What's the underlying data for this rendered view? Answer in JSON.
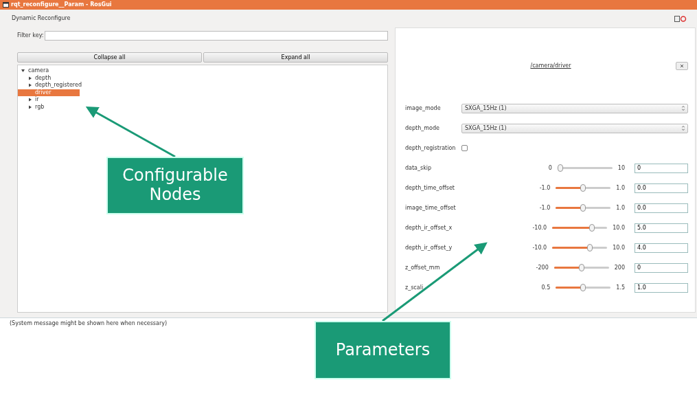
{
  "window": {
    "title": "rqt_reconfigure__Param - RosGui"
  },
  "header": {
    "title": "Dynamic Reconfigure"
  },
  "filter": {
    "label": "Filter key:"
  },
  "buttons": [
    "Collapse all",
    "Expand all"
  ],
  "tree": [
    {
      "label": "camera",
      "expanded": true,
      "selected": false,
      "children": [
        {
          "label": "depth",
          "expanded": false,
          "selected": false
        },
        {
          "label": "depth_registered",
          "expanded": false,
          "selected": false
        },
        {
          "label": "driver",
          "selected": true
        },
        {
          "label": "ir",
          "expanded": false,
          "selected": false
        },
        {
          "label": "rgb",
          "expanded": false,
          "selected": false
        }
      ]
    }
  ],
  "node": {
    "title": "/camera/driver"
  },
  "params": [
    {
      "name": "image_mode",
      "kind": "select",
      "value": "SXGA_15Hz (1)"
    },
    {
      "name": "depth_mode",
      "kind": "select",
      "value": "SXGA_15Hz (1)"
    },
    {
      "name": "depth_registration",
      "kind": "checkbox",
      "checked": false
    },
    {
      "name": "data_skip",
      "kind": "slider",
      "min": "0",
      "max": "10",
      "level": 0,
      "value": "0"
    },
    {
      "name": "depth_time_offset",
      "kind": "slider",
      "min": "-1.0",
      "max": "1.0",
      "level": 0.5,
      "value": "0.0"
    },
    {
      "name": "image_time_offset",
      "kind": "slider",
      "min": "-1.0",
      "max": "1.0",
      "level": 0.5,
      "value": "0.0"
    },
    {
      "name": "depth_ir_offset_x",
      "kind": "slider",
      "min": "-10.0",
      "max": "10.0",
      "level": 0.75,
      "value": "5.0"
    },
    {
      "name": "depth_ir_offset_y",
      "kind": "slider",
      "min": "-10.0",
      "max": "10.0",
      "level": 0.7,
      "value": "4.0"
    },
    {
      "name": "z_offset_mm",
      "kind": "slider",
      "min": "-200",
      "max": "200",
      "level": 0.5,
      "value": "0"
    },
    {
      "name": "z_scali",
      "kind": "slider",
      "min": "0.5",
      "max": "1.5",
      "level": 0.5,
      "value": "1.0"
    }
  ],
  "status_message": "(System message might be shown here when necessary)",
  "callouts": [
    {
      "text": "Configurable Nodes"
    },
    {
      "text": "Parameters"
    }
  ]
}
